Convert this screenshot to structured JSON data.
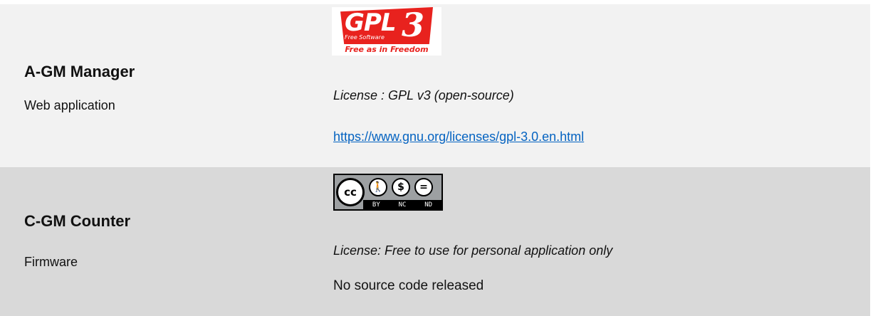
{
  "rows": [
    {
      "product_name": "A-GM Manager",
      "product_type": "Web application",
      "license_logo": {
        "icon": "gpl-v3-logo",
        "letters": "GPL",
        "version": "3",
        "subtitle": "Free Software",
        "tagline": "Free as in Freedom",
        "color": "#e8221e"
      },
      "license_label": "License : GPL v3 (open-source)",
      "license_link": "https://www.gnu.org/licenses/gpl-3.0.en.html"
    },
    {
      "product_name": "C-GM Counter",
      "product_type": "Firmware",
      "license_logo": {
        "icon": "cc-by-nc-nd-badge",
        "main": "cc",
        "icons": [
          "attribution-icon",
          "noncommercial-icon",
          "noderivatives-icon"
        ],
        "labels": [
          "BY",
          "NC",
          "ND"
        ]
      },
      "license_label": "License: Free to use for personal application only",
      "source_note": "No source code released"
    }
  ],
  "colors": {
    "row_1_background": "#f2f2f2",
    "row_2_background": "#d9d9d9",
    "link": "#0563c1"
  }
}
